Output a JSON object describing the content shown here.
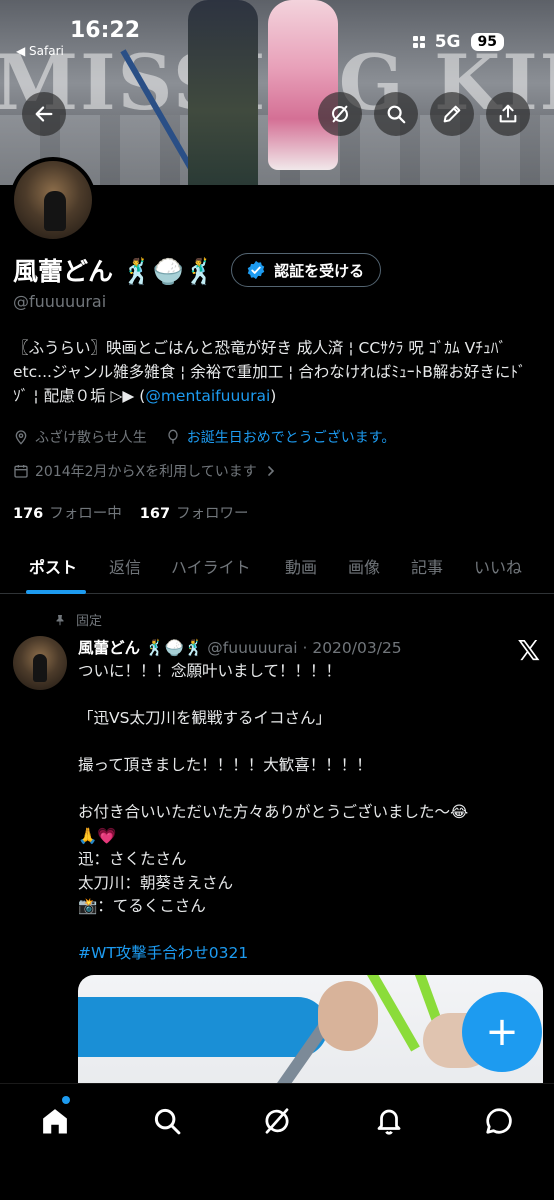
{
  "status_bar": {
    "time": "16:22",
    "back_label": "◀ Safari",
    "network": "5G",
    "battery": "95"
  },
  "banner": {
    "text": "MISSING KINGS"
  },
  "header_buttons": {
    "back_icon": "arrow-left-icon",
    "grok_icon": "grok-icon",
    "search_icon": "search-icon",
    "edit_icon": "pencil-icon",
    "share_icon": "share-icon"
  },
  "profile": {
    "name": "風蕾どん 🕺🍚🕺",
    "handle": "@fuuuuurai",
    "verify_label": "認証を受ける",
    "bio_text": "〖ふうらい〗映画とごはんと恐竜が好き 成人済 ¦ CCｻｸﾗ 呪 ｺﾞｶﾑ Vﾁｭﾊﾞetc...ジャンル雑多雑食 ¦ 余裕で重加工 ¦ 合わなければﾐｭｰﾄB解お好きにﾄﾞｿﾞ ¦ 配慮０垢 ▷▶ (",
    "bio_link": "@mentaifuuurai",
    "bio_end": ")",
    "location": "ふざけ散らせ人生",
    "birthday": "お誕生日おめでとうございます。",
    "joined": "2014年2月からXを利用しています",
    "following_count": "176",
    "following_label": "フォロー中",
    "followers_count": "167",
    "followers_label": "フォロワー"
  },
  "tabs": [
    "ポスト",
    "返信",
    "ハイライト",
    "動画",
    "画像",
    "記事",
    "いいね"
  ],
  "pinned_post": {
    "pinned_label": "固定",
    "author": "風蕾どん 🕺🍚🕺",
    "meta": "@fuuuuurai · 2020/03/25",
    "lines": [
      "ついに！！！念願叶いまして！！！！",
      "",
      "「迅VS太刀川を観戦するイコさん」",
      "",
      "撮って頂きました！！！！大歓喜！！！！",
      "",
      "お付き合いいただいた方々ありがとうございました〜😂",
      "🙏💗",
      "迅：さくたさん",
      "太刀川：朝葵きえさん",
      "📸：てるくこさん",
      ""
    ],
    "hashtag": "#WT攻撃手合わせ0321",
    "logo": "𝕏"
  },
  "fab_label": "+",
  "bottom_nav": [
    "home-icon",
    "search-icon",
    "grok-icon",
    "notifications-icon",
    "messages-icon"
  ]
}
